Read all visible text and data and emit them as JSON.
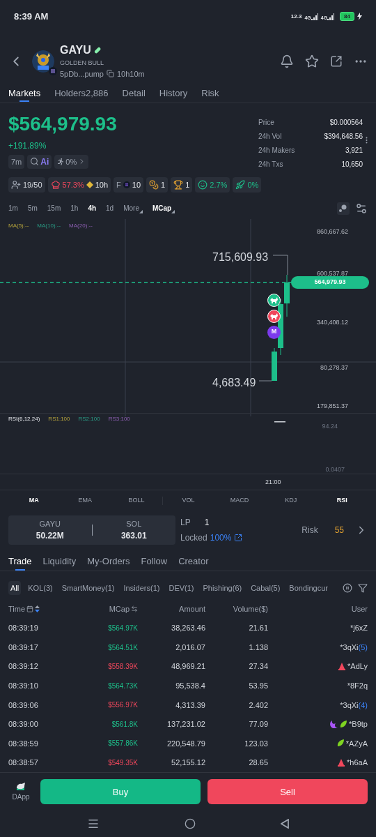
{
  "status_bar": {
    "time": "8:39 AM",
    "speed": "12.3",
    "network": [
      "4G",
      "4G"
    ],
    "battery": "84"
  },
  "header": {
    "name": "GAYU",
    "subtitle": "GOLDEN BULL",
    "address": "5pDb...pump",
    "age": "10h10m"
  },
  "tabs": [
    {
      "label": "Markets",
      "selected": true
    },
    {
      "label": "Holders2,886",
      "selected": false
    },
    {
      "label": "Detail",
      "selected": false
    },
    {
      "label": "History",
      "selected": false
    },
    {
      "label": "Risk",
      "selected": false
    }
  ],
  "price": {
    "value": "$564,979.93",
    "change": "+191.89%"
  },
  "stats": [
    {
      "label": "Price",
      "value": "$0.000564"
    },
    {
      "label": "24h Vol",
      "value": "$394,648.56"
    },
    {
      "label": "24h Makers",
      "value": "3,921"
    },
    {
      "label": "24h Txs",
      "value": "10,650"
    }
  ],
  "quick_chips": [
    {
      "kind": "text",
      "text": "7m"
    },
    {
      "kind": "ai",
      "text": "Ai"
    },
    {
      "kind": "run",
      "text": "0%"
    }
  ],
  "badges": [
    {
      "items": [
        {
          "kind": "user",
          "text": "19/50"
        }
      ]
    },
    {
      "items": [
        {
          "kind": "hat",
          "text": "57.3%"
        },
        {
          "kind": "diamond",
          "text": "10h"
        }
      ]
    },
    {
      "items": [
        {
          "kind": "letter",
          "text": "F"
        },
        {
          "kind": "coin",
          "text": "10"
        }
      ]
    },
    {
      "items": [
        {
          "kind": "bag",
          "text": "1"
        }
      ]
    },
    {
      "items": [
        {
          "kind": "trophy",
          "text": "1"
        }
      ]
    },
    {
      "items": [
        {
          "kind": "face",
          "text": "2.7%"
        }
      ]
    },
    {
      "items": [
        {
          "kind": "rocket",
          "text": "0%"
        }
      ]
    }
  ],
  "timeframes": [
    {
      "label": "1m",
      "selected": false
    },
    {
      "label": "5m",
      "selected": false
    },
    {
      "label": "15m",
      "selected": false
    },
    {
      "label": "1h",
      "selected": false
    },
    {
      "label": "4h",
      "selected": true
    },
    {
      "label": "1d",
      "selected": false
    },
    {
      "label": "More",
      "selected": false,
      "dropdown": true
    },
    {
      "label": "MCap",
      "selected": true,
      "dropdown": true
    }
  ],
  "chart": {
    "legend": [
      "MA(5):--",
      "MA(10):--",
      "MA(20):--"
    ],
    "y_labels": [
      "860,667.62",
      "600,537.87",
      "340,408.12",
      "80,278.37",
      "179,851.37"
    ],
    "high_label": "715,609.93",
    "low_label": "4,683.49",
    "price_tag": "564,979.93",
    "markers": [
      {
        "kind": "bull",
        "color": "#1dbf8a"
      },
      {
        "kind": "bull",
        "color": "#f0475c"
      },
      {
        "kind": "letter",
        "text": "M",
        "color": "#7c3aed"
      }
    ]
  },
  "rsi": {
    "legend": [
      "RSI(6,12,24)",
      "RS1:100",
      "RS2:100",
      "RS3:100"
    ],
    "labels": [
      "94.24",
      "0.0407"
    ],
    "time_label": "21:00"
  },
  "indicators": {
    "main": [
      {
        "label": "MA",
        "selected": true
      },
      {
        "label": "EMA",
        "selected": false
      },
      {
        "label": "BOLL",
        "selected": false
      }
    ],
    "sub": [
      {
        "label": "VOL",
        "selected": false
      },
      {
        "label": "MACD",
        "selected": false
      },
      {
        "label": "KDJ",
        "selected": false
      },
      {
        "label": "RSI",
        "selected": true
      }
    ]
  },
  "pool": {
    "token_a": {
      "label": "GAYU",
      "value": "50.22M"
    },
    "token_b": {
      "label": "SOL",
      "value": "363.01"
    },
    "lp_label": "LP",
    "lp_value": "1",
    "locked_label": "Locked",
    "locked_value": "100%",
    "risk_label": "Risk",
    "risk_value": "55"
  },
  "trade_tabs": [
    {
      "label": "Trade",
      "selected": true
    },
    {
      "label": "Liquidity",
      "selected": false
    },
    {
      "label": "My-Orders",
      "selected": false
    },
    {
      "label": "Follow",
      "selected": false
    },
    {
      "label": "Creator",
      "selected": false
    }
  ],
  "filters": [
    {
      "label": "All",
      "selected": true
    },
    {
      "label": "KOL(3)",
      "selected": false
    },
    {
      "label": "SmartMoney(1)",
      "selected": false
    },
    {
      "label": "Insiders(1)",
      "selected": false
    },
    {
      "label": "DEV(1)",
      "selected": false
    },
    {
      "label": "Phishing(6)",
      "selected": false
    },
    {
      "label": "Cabal(5)",
      "selected": false
    },
    {
      "label": "Bondingcur",
      "selected": false
    }
  ],
  "table": {
    "columns": [
      "Time",
      "MCap",
      "Amount",
      "Volume($)",
      "User"
    ],
    "rows": [
      {
        "time": "08:39:19",
        "mcap": "$564.97K",
        "sell": false,
        "amount": "38,263.46",
        "volume": "21.61",
        "user": "*j6xZ"
      },
      {
        "time": "08:39:17",
        "mcap": "$564.51K",
        "sell": false,
        "amount": "2,016.07",
        "volume": "1.138",
        "user": "*3qXi",
        "count": "(5)"
      },
      {
        "time": "08:39:12",
        "mcap": "$558.39K",
        "sell": true,
        "amount": "48,969.21",
        "volume": "27.34",
        "user": "*AdLy",
        "tags": [
          {
            "kind": "cone"
          }
        ]
      },
      {
        "time": "08:39:10",
        "mcap": "$564.73K",
        "sell": false,
        "amount": "95,538.4",
        "volume": "53.95",
        "user": "*8F2q"
      },
      {
        "time": "08:39:06",
        "mcap": "$556.97K",
        "sell": true,
        "amount": "4,313.39",
        "volume": "2.402",
        "user": "*3qXi",
        "count": "(4)"
      },
      {
        "time": "08:39:00",
        "mcap": "$561.8K",
        "sell": false,
        "amount": "137,231.02",
        "volume": "77.09",
        "user": "*B9tp",
        "tags": [
          {
            "kind": "crescent"
          },
          {
            "kind": "leaf"
          }
        ]
      },
      {
        "time": "08:38:59",
        "mcap": "$557.86K",
        "sell": false,
        "amount": "220,548.79",
        "volume": "123.03",
        "user": "*AZyA",
        "tags": [
          {
            "kind": "leaf"
          }
        ]
      },
      {
        "time": "08:38:57",
        "mcap": "$549.35K",
        "sell": true,
        "amount": "52,155.12",
        "volume": "28.65",
        "user": "*h6aA",
        "tags": [
          {
            "kind": "cone"
          }
        ]
      }
    ]
  },
  "bottom_bar": {
    "dapp": "DApp",
    "buy": "Buy",
    "sell": "Sell"
  }
}
